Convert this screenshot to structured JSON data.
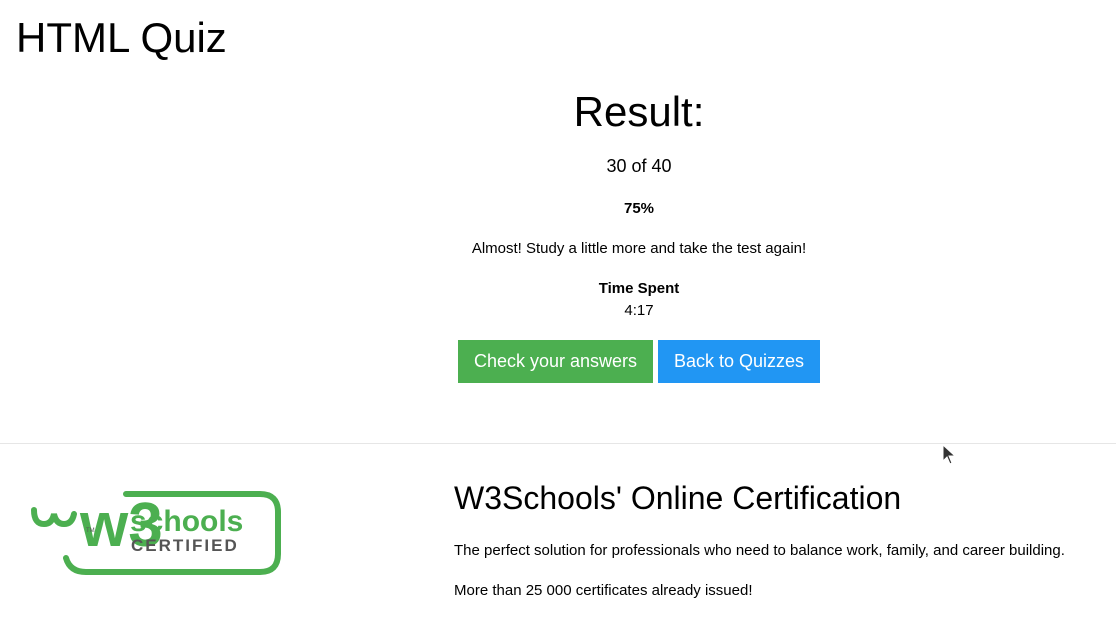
{
  "page": {
    "title": "HTML Quiz"
  },
  "result": {
    "heading": "Result:",
    "score": "30 of 40",
    "percent": "75%",
    "message": "Almost! Study a little more and take the test again!",
    "time_label": "Time Spent",
    "time_value": "4:17"
  },
  "actions": {
    "check_answers_label": "Check your answers",
    "back_label": "Back to Quizzes"
  },
  "certification": {
    "logo_text_top": "schools",
    "logo_text_bottom": "CERTIFIED",
    "logo_mark": "w3",
    "logo_tm": "TM",
    "title": "W3Schools' Online Certification",
    "description": "The perfect solution for professionals who need to balance work, family, and career building.",
    "count_text": "More than 25 000 certificates already issued!"
  },
  "colors": {
    "check_button": "#4CAF50",
    "back_button": "#2196F3",
    "logo_green": "#4CAF50",
    "logo_gray": "#555555"
  }
}
